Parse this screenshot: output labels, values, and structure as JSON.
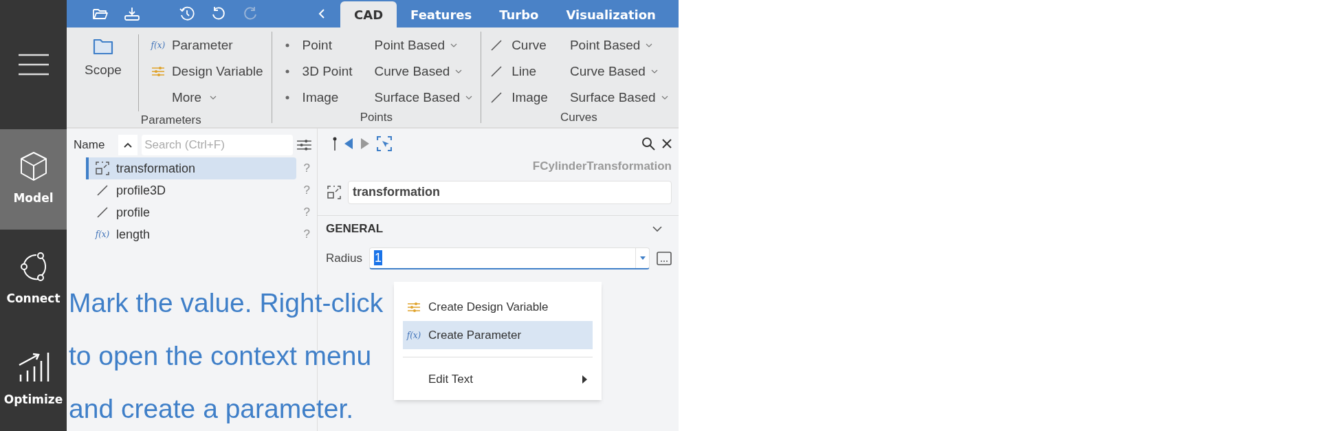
{
  "rail": {
    "items": [
      {
        "label": "Model",
        "kind": "cube",
        "selected": true
      },
      {
        "label": "Connect",
        "kind": "network",
        "selected": false
      },
      {
        "label": "Optimize",
        "kind": "chart",
        "selected": false
      }
    ]
  },
  "tabs": [
    {
      "label": "CAD",
      "selected": true
    },
    {
      "label": "Features",
      "selected": false
    },
    {
      "label": "Turbo",
      "selected": false
    },
    {
      "label": "Visualization",
      "selected": false
    }
  ],
  "ribbon": {
    "groups": [
      {
        "label": "Parameters",
        "kind": "parameters",
        "scope": "Scope",
        "items": [
          {
            "label": "Parameter",
            "kind": "fx",
            "icon_text": "f(x)"
          },
          {
            "label": "Design Variable",
            "kind": "sliders"
          }
        ],
        "more": "More"
      },
      {
        "label": "Points",
        "kind": "list",
        "items": [
          {
            "label": "Point",
            "kind": "dot"
          },
          {
            "label": "3D Point",
            "kind": "dot"
          },
          {
            "label": "Image",
            "kind": "dot"
          }
        ],
        "dropdowns": [
          "Point Based",
          "Curve Based",
          "Surface Based"
        ]
      },
      {
        "label": "Curves",
        "kind": "list",
        "items": [
          {
            "label": "Curve",
            "kind": "line"
          },
          {
            "label": "Line",
            "kind": "line"
          },
          {
            "label": "Image",
            "kind": "line"
          }
        ],
        "dropdowns": [
          "Point Based",
          "Curve Based",
          "Surface Based"
        ]
      }
    ]
  },
  "tree": {
    "column": "Name",
    "search": {
      "placeholder": "Search (Ctrl+F)"
    },
    "items": [
      {
        "label": "transformation",
        "kind": "transform",
        "selected": true,
        "help": "?"
      },
      {
        "label": "profile3D",
        "kind": "line",
        "selected": false,
        "help": "?"
      },
      {
        "label": "profile",
        "kind": "line",
        "selected": false,
        "help": "?"
      },
      {
        "label": "length",
        "kind": "fx",
        "icon_text": "f(x)",
        "selected": false,
        "help": "?"
      }
    ]
  },
  "inspector": {
    "type": "FCylinderTransformation",
    "name": "transformation",
    "section": {
      "title": "GENERAL",
      "expanded": true
    },
    "fields": [
      {
        "label": "Radius",
        "value": "1"
      }
    ]
  },
  "context_menu": {
    "items": [
      {
        "label": "Create Design Variable",
        "kind": "sliders",
        "selected": false
      },
      {
        "label": "Create Parameter",
        "kind": "fx",
        "icon_text": "f(x)",
        "selected": true
      },
      {
        "label": "Edit Text",
        "kind": "submenu",
        "selected": false
      }
    ]
  },
  "caption": "Mark the value. Right-click to open the context menu and create a parameter."
}
